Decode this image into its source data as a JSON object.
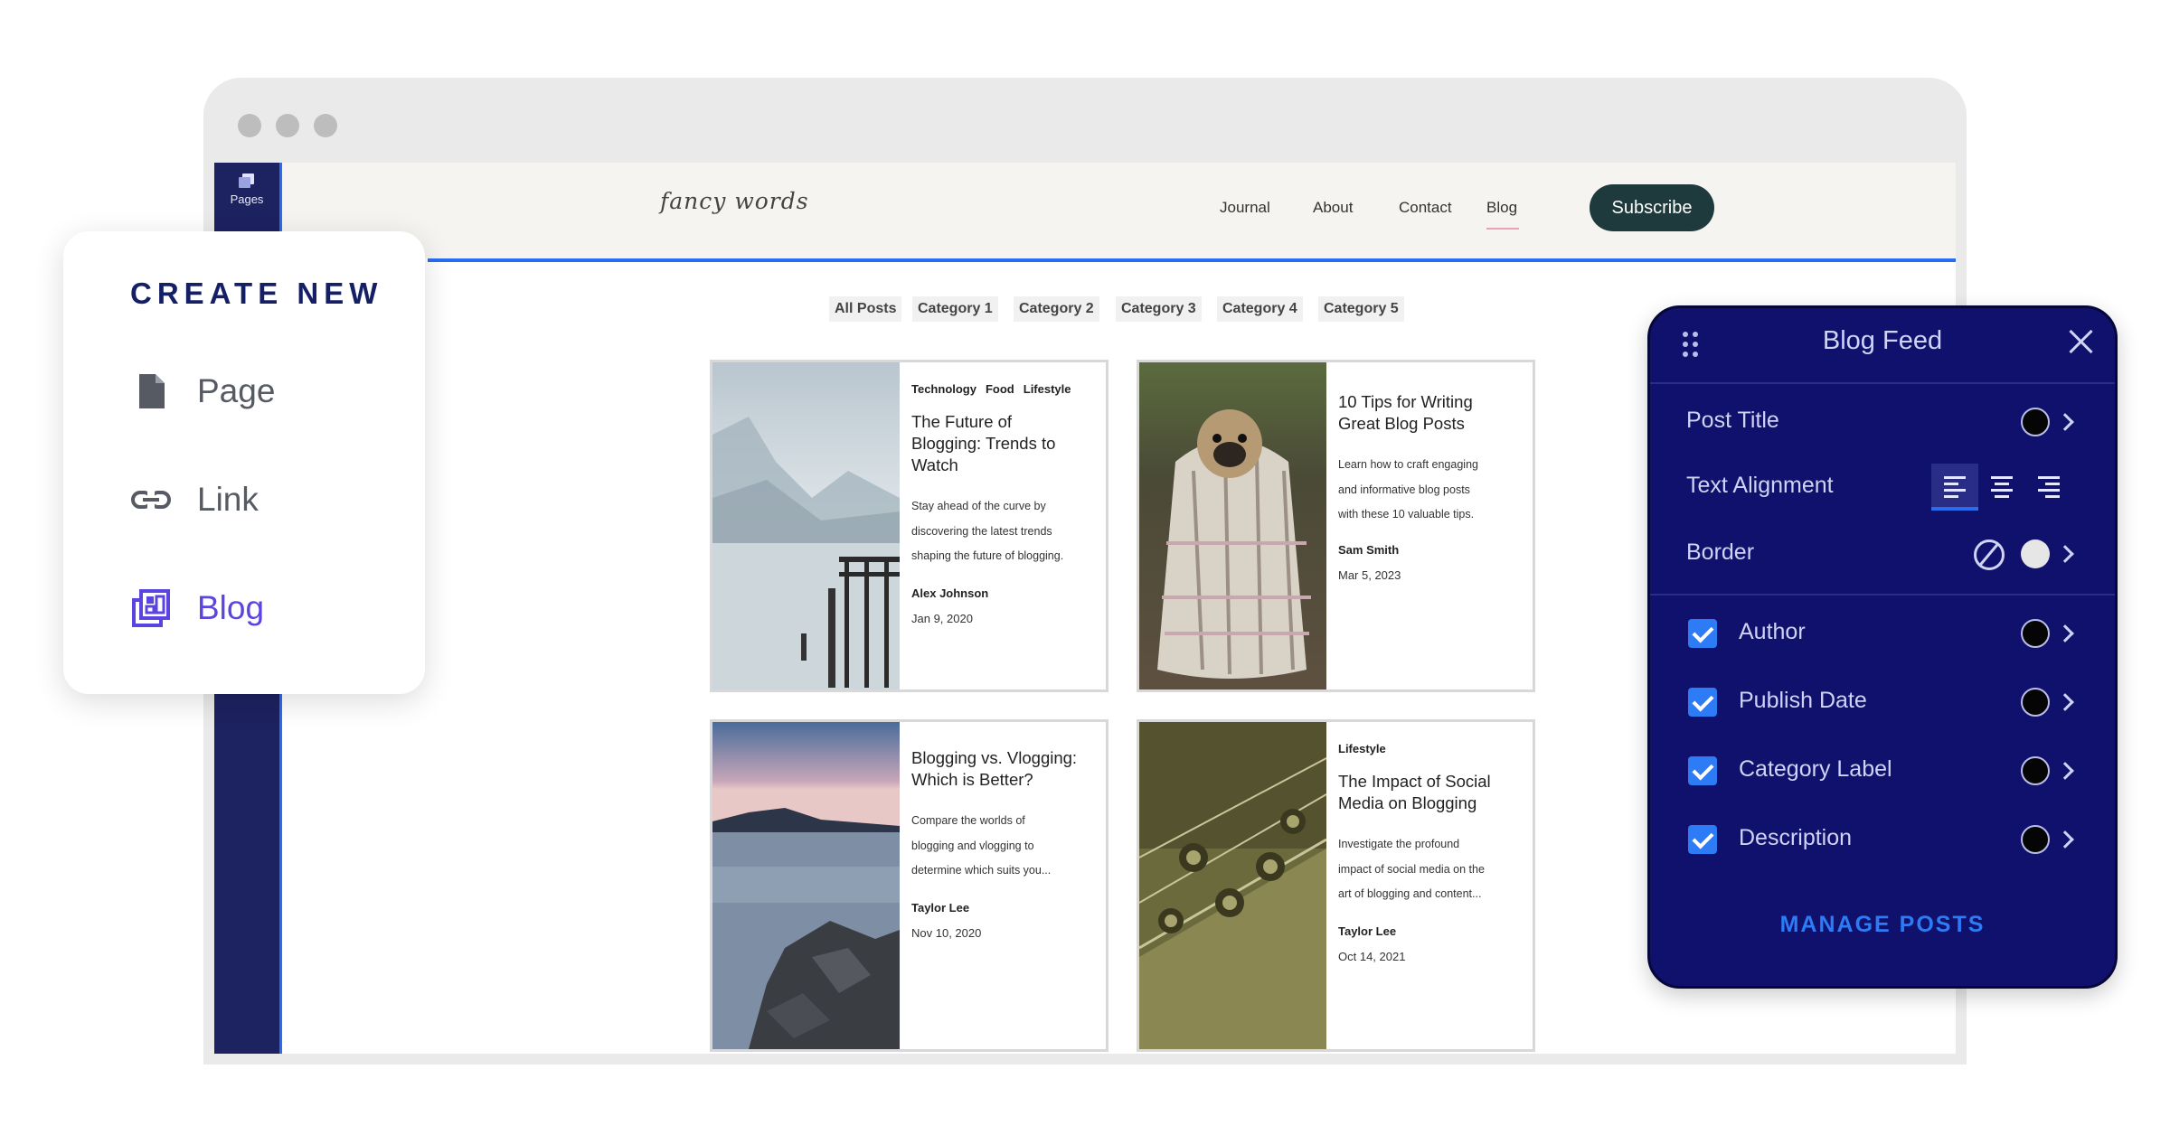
{
  "sidebar": {
    "pages_label": "Pages"
  },
  "site": {
    "logo": "fancy words",
    "nav": [
      "Journal",
      "About",
      "Contact",
      "Blog"
    ],
    "subscribe": "Subscribe",
    "categories": [
      "All Posts",
      "Category 1",
      "Category 2",
      "Category 3",
      "Category 4",
      "Category 5"
    ]
  },
  "posts": [
    {
      "tags": [
        "Technology",
        "Food",
        "Lifestyle"
      ],
      "title": "The Future of Blogging: Trends to Watch",
      "title_lines": [
        "The Future of",
        "Blogging: Trends to",
        "Watch"
      ],
      "description_lines": [
        "Stay ahead of the curve by",
        "discovering the latest trends",
        "shaping the future of blogging."
      ],
      "author": "Alex Johnson",
      "date": "Jan 9, 2020",
      "image": "misty lake with wooden pier"
    },
    {
      "tags": [],
      "title": "10 Tips for Writing Great Blog Posts",
      "title_lines": [
        "10 Tips for Writing",
        "Great Blog Posts"
      ],
      "description_lines": [
        "Learn how to craft engaging",
        "and informative blog posts",
        "with these 10 valuable tips."
      ],
      "author": "Sam Smith",
      "date": "Mar 5, 2023",
      "image": "pug wrapped in plaid blanket"
    },
    {
      "tags": [],
      "title": "Blogging vs. Vlogging: Which is Better?",
      "title_lines": [
        "Blogging vs. Vlogging:",
        "Which is Better?"
      ],
      "description_lines": [
        "Compare the worlds of",
        "blogging and vlogging to",
        "determine which suits you..."
      ],
      "author": "Taylor Lee",
      "date": "Nov 10, 2020",
      "image": "rocky shore at dusk"
    },
    {
      "tags": [
        "Lifestyle"
      ],
      "title": "The Impact of Social Media on Blogging",
      "title_lines": [
        "The Impact of Social",
        "Media on Blogging"
      ],
      "description_lines": [
        "Investigate the profound",
        "impact of social media on the",
        "art of blogging and content..."
      ],
      "author": "Taylor Lee",
      "date": "Oct 14, 2021",
      "image": "guitar headstock tuning pegs"
    }
  ],
  "create_new": {
    "title": "CREATE NEW",
    "items": [
      {
        "label": "Page",
        "icon": "page-icon"
      },
      {
        "label": "Link",
        "icon": "link-icon"
      },
      {
        "label": "Blog",
        "icon": "blog-icon"
      }
    ]
  },
  "blog_feed_panel": {
    "title": "Blog Feed",
    "post_title_label": "Post Title",
    "text_alignment_label": "Text Alignment",
    "text_alignment_selected": "left",
    "border_label": "Border",
    "toggles": [
      {
        "label": "Author",
        "checked": true
      },
      {
        "label": "Publish Date",
        "checked": true
      },
      {
        "label": "Category Label",
        "checked": true
      },
      {
        "label": "Description",
        "checked": true
      }
    ],
    "manage_posts": "MANAGE POSTS"
  },
  "colors": {
    "editor_navy": "#1d2260",
    "panel_navy": "#10116d",
    "accent_blue": "#2a6cf0",
    "blog_purple": "#5b45e0",
    "subscribe_green": "#1f3a3d"
  }
}
